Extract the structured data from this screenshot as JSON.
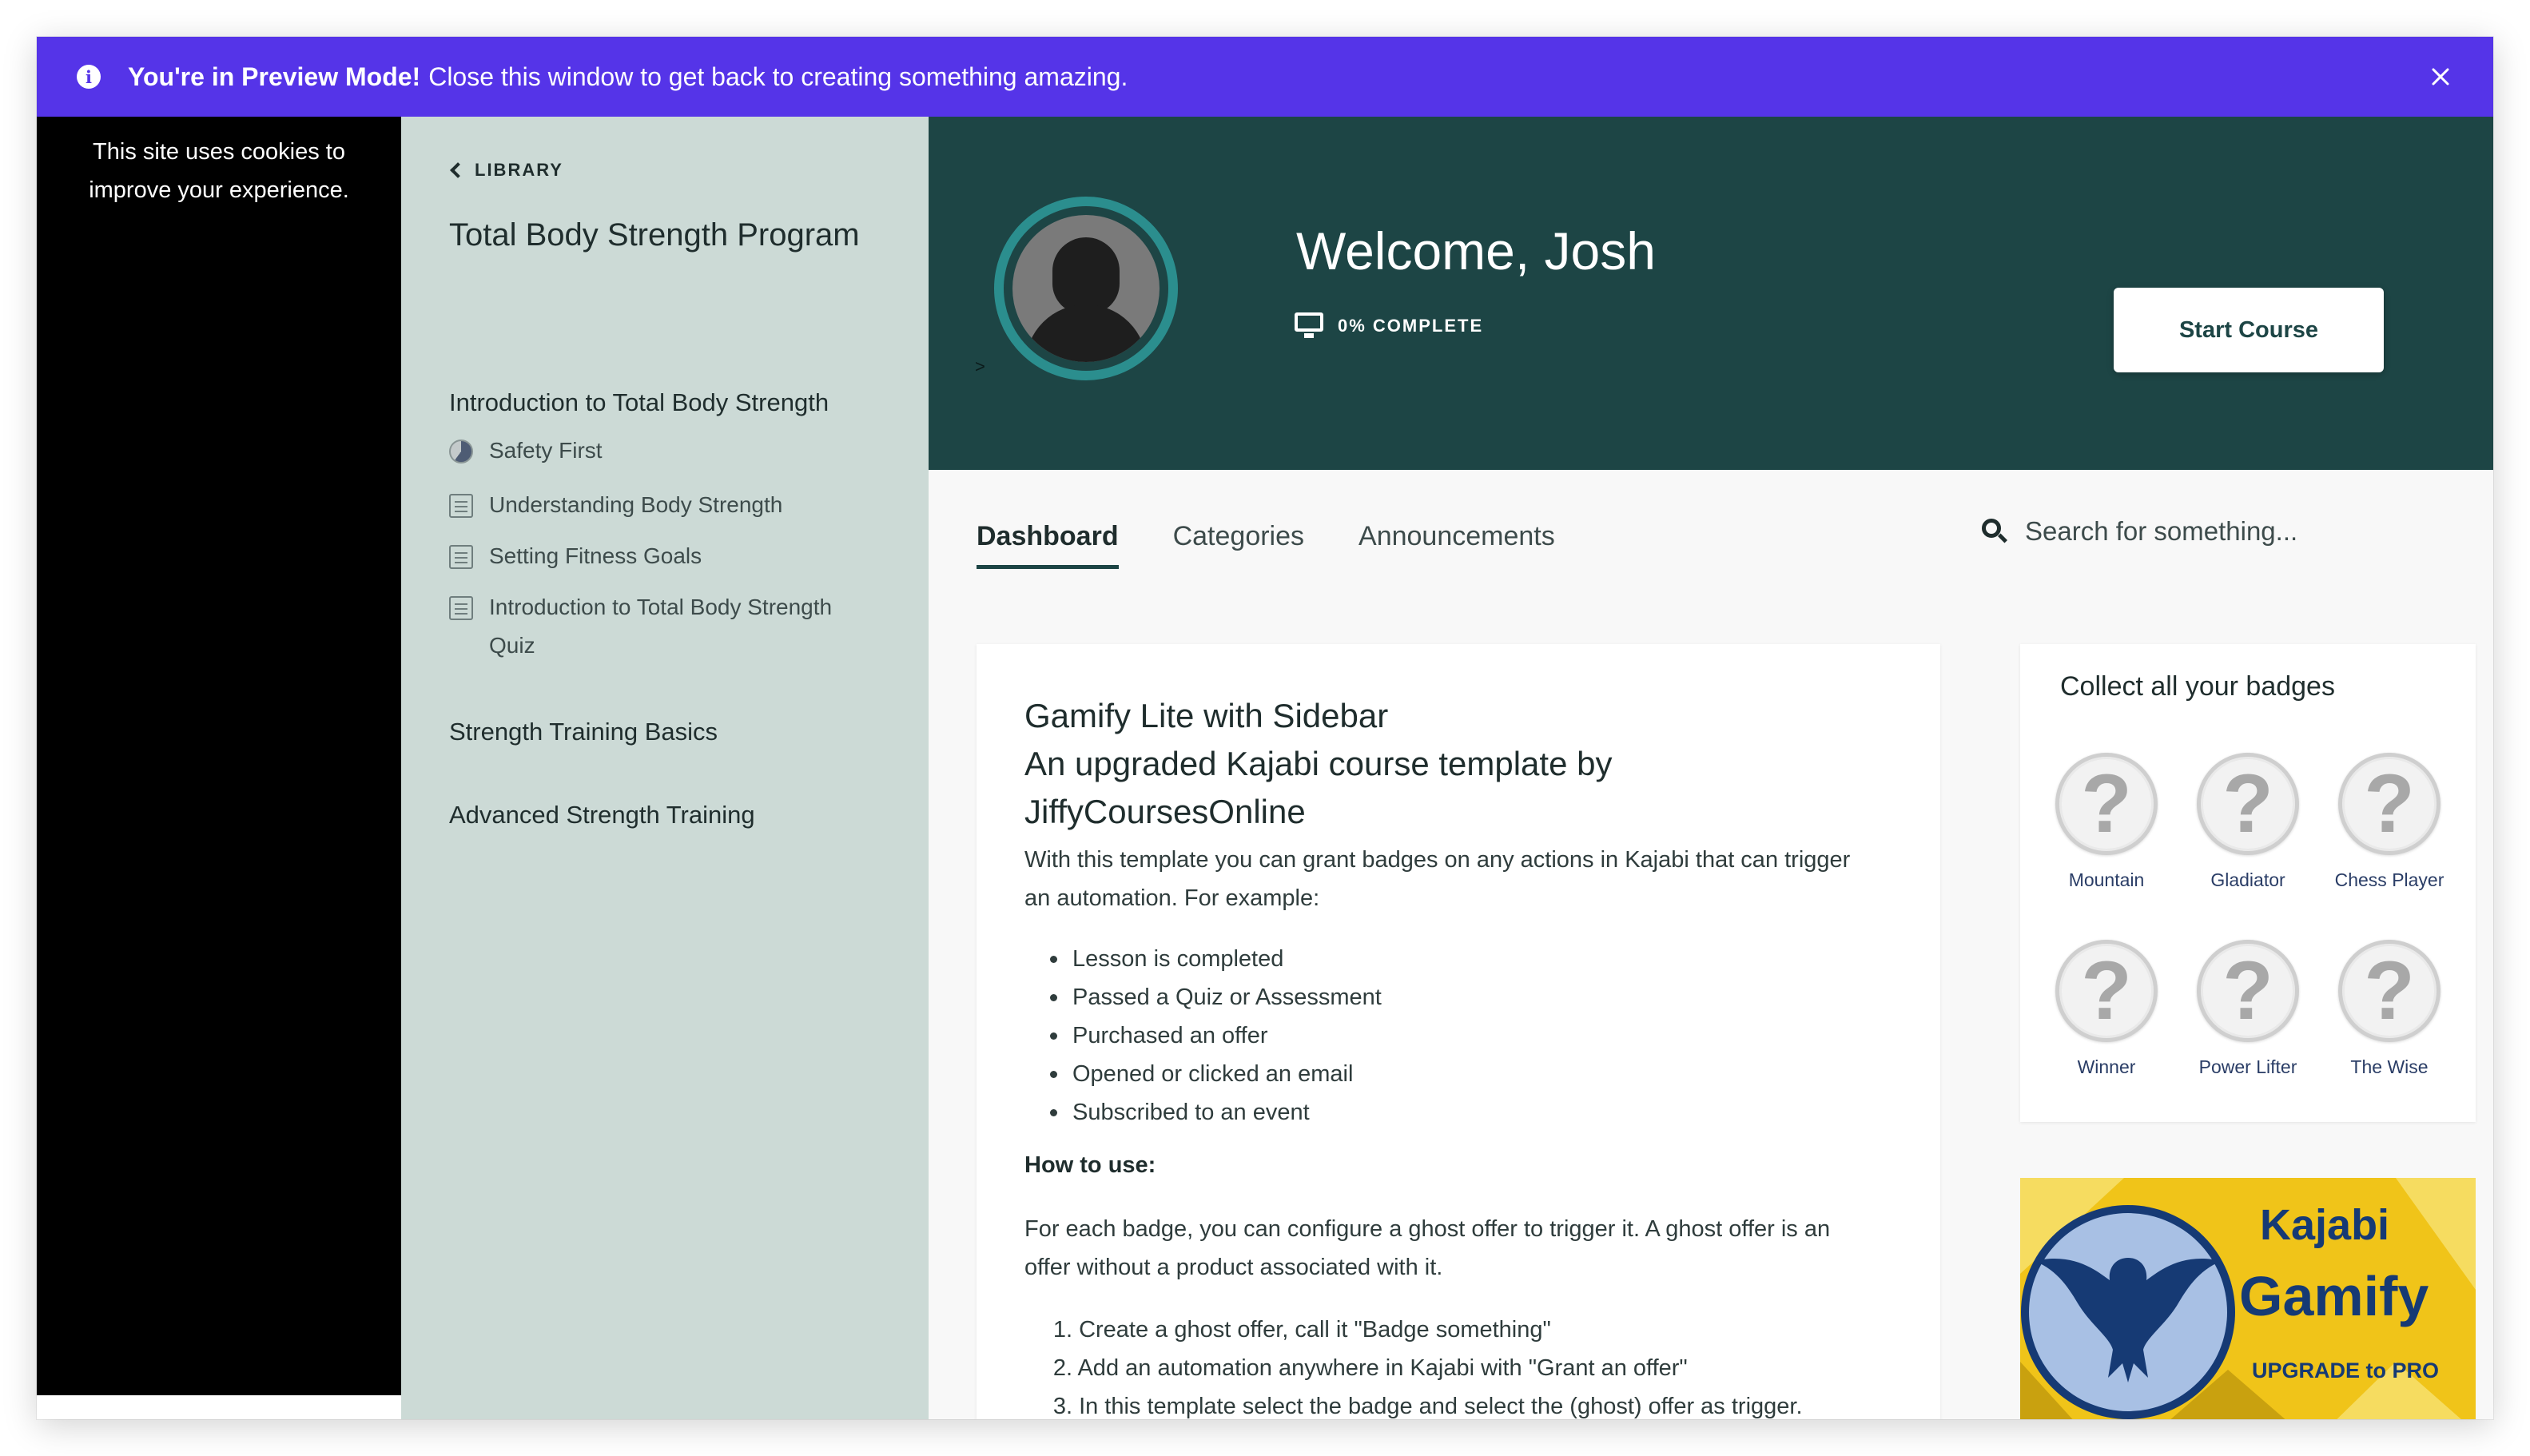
{
  "banner": {
    "bold_text": "You're in Preview Mode!",
    "text": "Close this window to get back to creating something amazing.",
    "close_icon": "close-icon"
  },
  "cookie_notice": {
    "line1": "This site uses cookies to",
    "line2": "improve your experience."
  },
  "sidebar": {
    "library_label": "LIBRARY",
    "course_title": "Total Body Strength Program",
    "modules": [
      {
        "title": "Introduction to Total Body Strength",
        "lessons": [
          {
            "label": "Safety First",
            "icon": "progress-icon"
          },
          {
            "label": "Understanding Body Strength",
            "icon": "document-icon"
          },
          {
            "label": "Setting Fitness Goals",
            "icon": "document-icon"
          },
          {
            "label": "Introduction to Total Body Strength",
            "label_line2": "Quiz",
            "icon": "document-icon"
          }
        ]
      },
      {
        "title": "Strength Training Basics"
      },
      {
        "title": "Advanced Strength Training"
      }
    ]
  },
  "hero": {
    "welcome": "Welcome, Josh",
    "complete": "0% COMPLETE",
    "caret": ">",
    "start_button": "Start Course",
    "colors": {
      "background": "#1d4545",
      "ring": "#2b8e8e"
    }
  },
  "tabs": [
    {
      "label": "Dashboard",
      "active": true
    },
    {
      "label": "Categories",
      "active": false
    },
    {
      "label": "Announcements",
      "active": false
    }
  ],
  "search": {
    "placeholder": "Search for something..."
  },
  "content": {
    "title_line1": "Gamify Lite with Sidebar",
    "title_line2": "An upgraded Kajabi course template by",
    "title_line3": "JiffyCoursesOnline",
    "intro_line1": "With this template you can grant badges on any actions in Kajabi that can trigger",
    "intro_line2": "an automation. For example:",
    "bullets": [
      "Lesson is completed",
      "Passed a Quiz or Assessment",
      "Purchased an offer",
      "Opened or clicked an email",
      "Subscribed to an event"
    ],
    "how_to": "How to use:",
    "howto_line1": "For each badge, you can configure a ghost offer to trigger it. A ghost offer is an",
    "howto_line2": "offer without a product associated with it.",
    "steps": [
      {
        "num": "1.",
        "text": "Create a ghost offer, call it \"Badge something\""
      },
      {
        "num": "2.",
        "text": "Add an automation anywhere in Kajabi with \"Grant an offer\""
      },
      {
        "num": "3.",
        "text": "In this template select the badge and select the (ghost) offer as trigger."
      }
    ]
  },
  "badges": {
    "title": "Collect all your badges",
    "items": [
      {
        "label": "Mountain",
        "symbol": "?"
      },
      {
        "label": "Gladiator",
        "symbol": "?"
      },
      {
        "label": "Chess Player",
        "symbol": "?"
      },
      {
        "label": "Winner",
        "symbol": "?"
      },
      {
        "label": "Power Lifter",
        "symbol": "?"
      },
      {
        "label": "The Wise",
        "symbol": "?"
      }
    ]
  },
  "promo": {
    "word1": "Kajabi",
    "word2": "Gamify",
    "upgrade": "UPGRADE to PRO",
    "icon": "owl-icon",
    "colors": {
      "yellow": "#f0c419",
      "navy": "#163a74",
      "circle": "#a8c0e4"
    }
  },
  "colors": {
    "banner": "#5534e8",
    "sidebar": "#ccdad6",
    "accent": "#1d4545"
  }
}
